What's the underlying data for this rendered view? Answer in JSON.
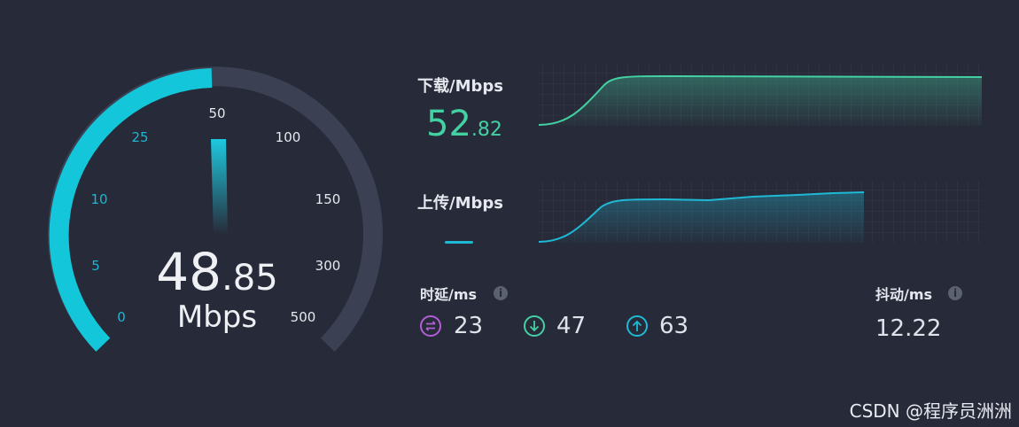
{
  "gauge": {
    "current_value_int": "48",
    "current_value_frac": ".85",
    "unit": "Mbps",
    "scale_labels": [
      "0",
      "5",
      "10",
      "25",
      "50",
      "100",
      "150",
      "300",
      "500"
    ],
    "fill_fraction": 0.45,
    "active_color": "#13c6da",
    "track_color": "#3b4052"
  },
  "download": {
    "label": "下载/Mbps",
    "value_int": "52",
    "value_frac": ".82",
    "color": "#43d1a3"
  },
  "upload": {
    "label": "上传/Mbps",
    "color": "#1fb9d6"
  },
  "latency": {
    "label": "时延/ms",
    "info_icon": "i",
    "items": [
      {
        "icon": "swap-icon",
        "value": "23",
        "color": "#b05fd6"
      },
      {
        "icon": "arrow-down-icon",
        "value": "47",
        "color": "#43d1a3"
      },
      {
        "icon": "arrow-up-icon",
        "value": "63",
        "color": "#1fb9d6"
      }
    ]
  },
  "jitter": {
    "label": "抖动/ms",
    "info_icon": "i",
    "value": "12.22"
  },
  "watermark": "CSDN @程序员洲洲"
}
